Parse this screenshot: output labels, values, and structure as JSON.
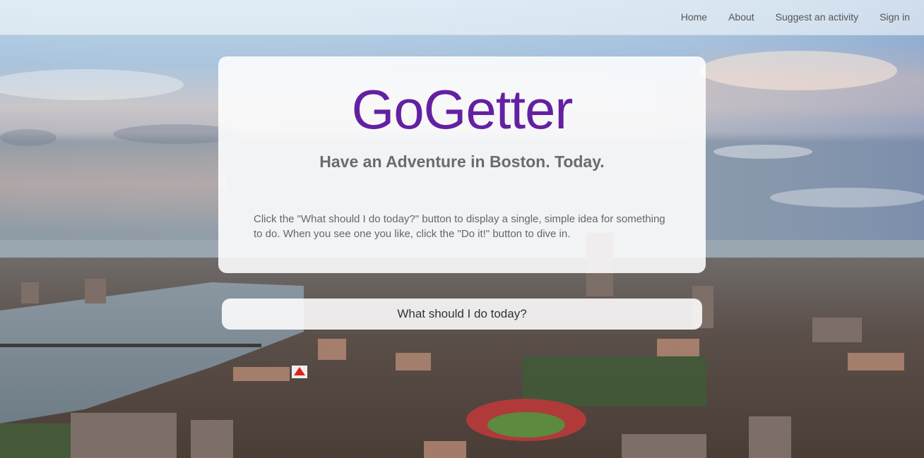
{
  "nav": {
    "items": [
      {
        "label": "Home"
      },
      {
        "label": "About"
      },
      {
        "label": "Suggest an activity"
      },
      {
        "label": "Sign in"
      }
    ]
  },
  "hero": {
    "brand": "GoGetter",
    "tagline": "Have an Adventure in Boston. Today.",
    "description": "Click the \"What should I do today?\" button to display a single, simple idea for something to do. When you see one you like, click the \"Do it!\" button to dive in."
  },
  "cta": {
    "label": "What should I do today?"
  },
  "colors": {
    "brand": "#6420a2",
    "tagline": "#6b6b6b",
    "card": "#ffffff"
  }
}
